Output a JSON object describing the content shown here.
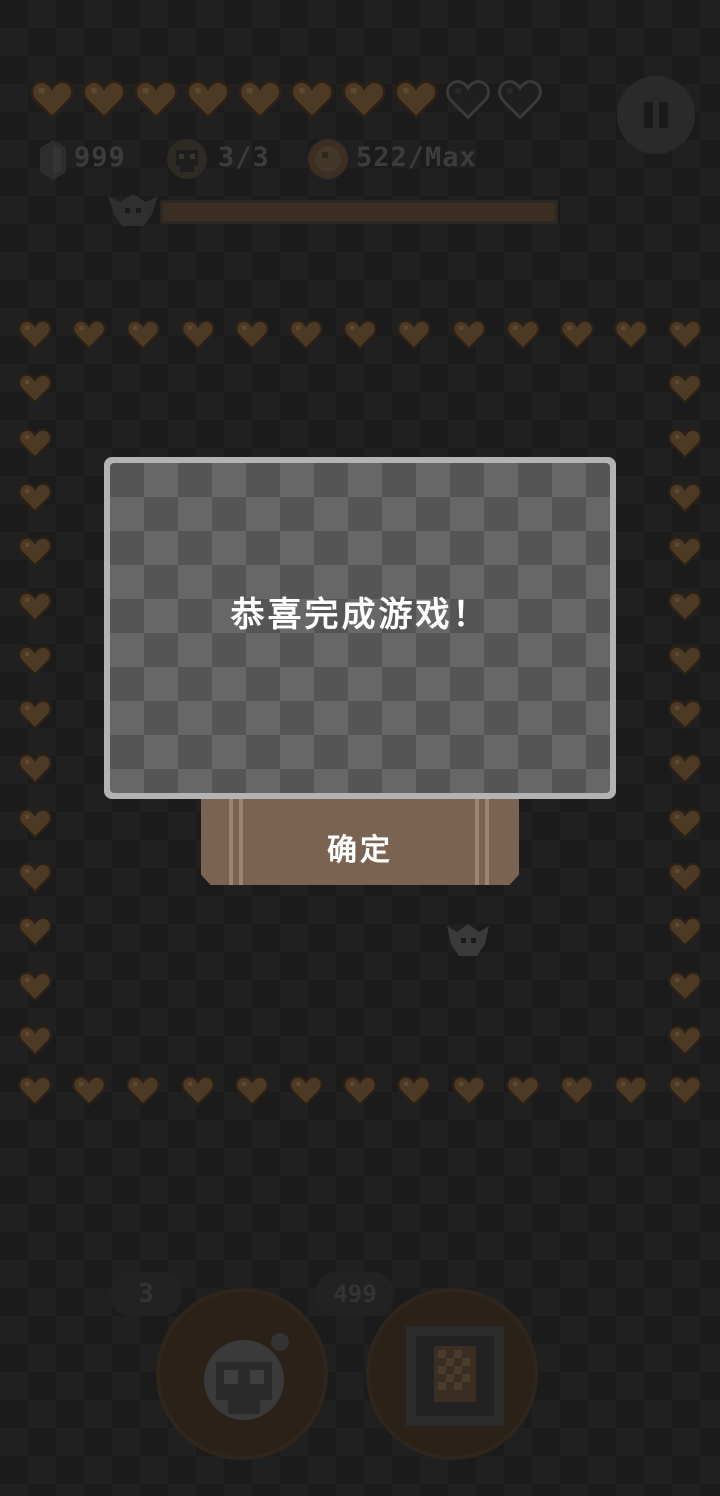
{
  "hud": {
    "hearts_full": 8,
    "hearts_empty": 2,
    "gem_count": "999",
    "skull_count": "3/3",
    "coin_count": "522/Max"
  },
  "dialog": {
    "message": "恭喜完成游戏！",
    "confirm_label": "确定"
  },
  "bottom": {
    "skill1_count": "3",
    "skill2_cost": "499"
  },
  "colors": {
    "heart_dim": "#4d3a24",
    "dialog_frame": "#b3b3b3",
    "button": "#7a6350"
  }
}
